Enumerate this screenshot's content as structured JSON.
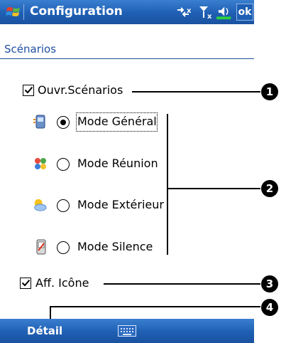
{
  "titlebar": {
    "title": "Configuration",
    "ok_label": "ok"
  },
  "header": {
    "section_title": "Scénarios"
  },
  "options": {
    "open_scenarios": {
      "label": "Ouvr.Scénarios",
      "checked": true
    },
    "show_icon": {
      "label": "Aff. Icône",
      "checked": true
    }
  },
  "modes": [
    {
      "label": "Mode Général",
      "selected": true,
      "icon": "general-mode-icon"
    },
    {
      "label": "Mode Réunion",
      "selected": false,
      "icon": "meeting-mode-icon"
    },
    {
      "label": "Mode Extérieur",
      "selected": false,
      "icon": "outdoor-mode-icon"
    },
    {
      "label": "Mode Silence",
      "selected": false,
      "icon": "silent-mode-icon"
    }
  ],
  "callouts": [
    "1",
    "2",
    "3",
    "4"
  ],
  "menubar": {
    "left_label": "Détail"
  },
  "colors": {
    "bar_blue": "#1f5fb3",
    "accent_blue": "#1f4fa0"
  }
}
